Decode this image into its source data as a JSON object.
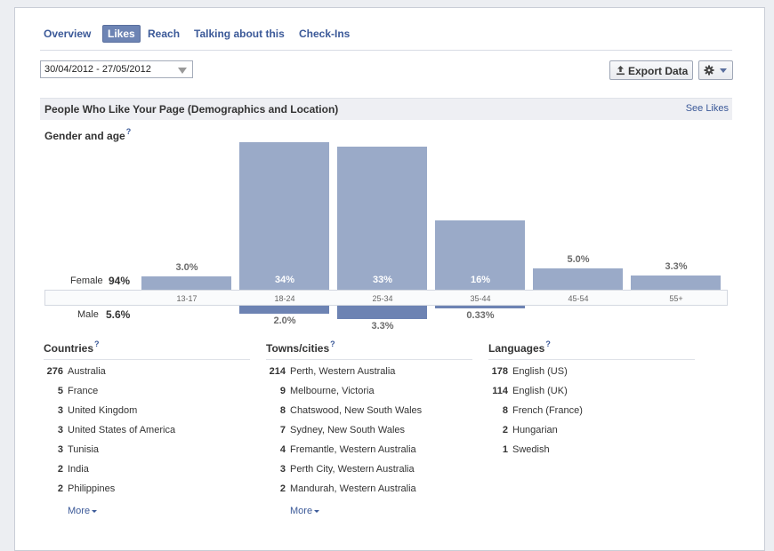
{
  "tabs": [
    "Overview",
    "Likes",
    "Reach",
    "Talking about this",
    "Check-Ins"
  ],
  "active_tab": "Likes",
  "date_range": "30/04/2012 - 27/05/2012",
  "export_label": "Export Data",
  "section": {
    "title": "People Who Like Your Page (Demographics and Location)",
    "link": "See Likes"
  },
  "gender_age": {
    "title": "Gender and age",
    "help": "?",
    "female_label": "Female",
    "female_pct": "94%",
    "male_label": "Male",
    "male_pct": "5.6%"
  },
  "chart_data": {
    "type": "bar",
    "categories": [
      "13-17",
      "18-24",
      "25-34",
      "35-44",
      "45-54",
      "55+"
    ],
    "series": [
      {
        "name": "Female",
        "values": [
          3.0,
          34,
          33,
          16,
          5.0,
          3.3
        ],
        "labels": [
          "3.0%",
          "34%",
          "33%",
          "16%",
          "5.0%",
          "3.3%"
        ]
      },
      {
        "name": "Male",
        "values": [
          0,
          2.0,
          3.3,
          0.33,
          0,
          0
        ],
        "labels": [
          "",
          "2.0%",
          "3.3%",
          "0.33%",
          "",
          ""
        ]
      }
    ],
    "colors": {
      "female": "#9aaac8",
      "male": "#6d83b3"
    }
  },
  "countries": {
    "title": "Countries",
    "help": "?",
    "items": [
      {
        "count": "276",
        "name": "Australia"
      },
      {
        "count": "5",
        "name": "France"
      },
      {
        "count": "3",
        "name": "United Kingdom"
      },
      {
        "count": "3",
        "name": "United States of America"
      },
      {
        "count": "3",
        "name": "Tunisia"
      },
      {
        "count": "2",
        "name": "India"
      },
      {
        "count": "2",
        "name": "Philippines"
      }
    ],
    "more": "More"
  },
  "cities": {
    "title": "Towns/cities",
    "help": "?",
    "items": [
      {
        "count": "214",
        "name": "Perth, Western Australia"
      },
      {
        "count": "9",
        "name": "Melbourne, Victoria"
      },
      {
        "count": "8",
        "name": "Chatswood, New South Wales"
      },
      {
        "count": "7",
        "name": "Sydney, New South Wales"
      },
      {
        "count": "4",
        "name": "Fremantle, Western Australia"
      },
      {
        "count": "3",
        "name": "Perth City, Western Australia"
      },
      {
        "count": "2",
        "name": "Mandurah, Western Australia"
      }
    ],
    "more": "More"
  },
  "languages": {
    "title": "Languages",
    "help": "?",
    "items": [
      {
        "count": "178",
        "name": "English (US)"
      },
      {
        "count": "114",
        "name": "English (UK)"
      },
      {
        "count": "8",
        "name": "French (France)"
      },
      {
        "count": "2",
        "name": "Hungarian"
      },
      {
        "count": "1",
        "name": "Swedish"
      }
    ]
  }
}
